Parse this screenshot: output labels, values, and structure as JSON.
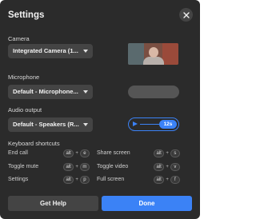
{
  "dialog": {
    "title": "Settings"
  },
  "camera": {
    "label": "Camera",
    "selected": "Integrated Camera (1..."
  },
  "microphone": {
    "label": "Microphone",
    "selected": "Default - Microphone..."
  },
  "audio_output": {
    "label": "Audio output",
    "selected": "Default - Speakers (R...",
    "test_duration": "12s"
  },
  "shortcuts": {
    "heading": "Keyboard shortcuts",
    "items": [
      {
        "label": "End call",
        "keys": [
          "alt",
          "e"
        ]
      },
      {
        "label": "Share screen",
        "keys": [
          "alt",
          "s"
        ]
      },
      {
        "label": "Toggle mute",
        "keys": [
          "alt",
          "m"
        ]
      },
      {
        "label": "Toggle video",
        "keys": [
          "alt",
          "v"
        ]
      },
      {
        "label": "Settings",
        "keys": [
          "alt",
          "p"
        ]
      },
      {
        "label": "Full screen",
        "keys": [
          "alt",
          "f"
        ]
      }
    ],
    "plus": "+"
  },
  "buttons": {
    "help": "Get Help",
    "done": "Done"
  },
  "colors": {
    "background": "#2b2b2b",
    "control": "#444444",
    "accent": "#3b82f6"
  },
  "icons": {
    "close": "close-icon",
    "caret": "chevron-down-icon",
    "play": "play-icon"
  }
}
